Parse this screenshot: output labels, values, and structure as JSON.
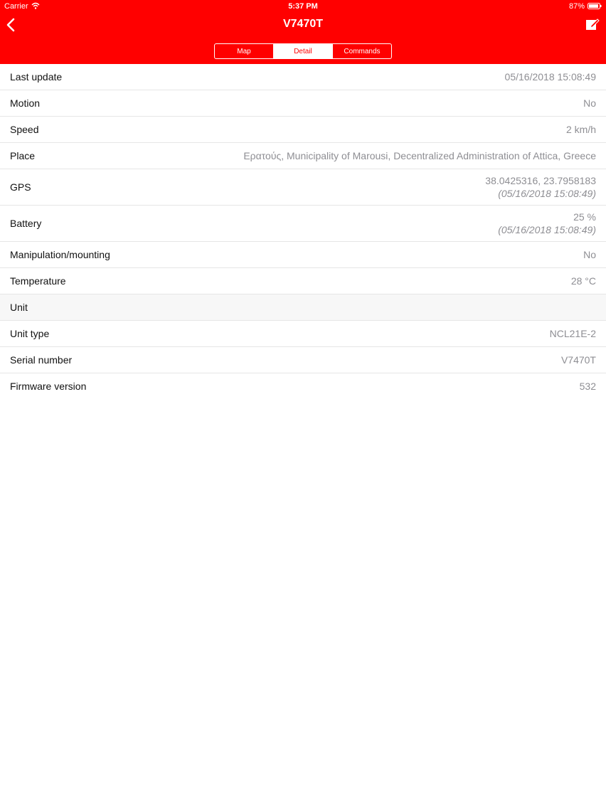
{
  "status_bar": {
    "carrier": "Carrier",
    "time": "5:37 PM",
    "battery": "87%"
  },
  "nav": {
    "title": "V7470T",
    "tabs": [
      {
        "label": "Map",
        "active": false
      },
      {
        "label": "Detail",
        "active": true
      },
      {
        "label": "Commands",
        "active": false
      }
    ],
    "accent_color": "#ff0000"
  },
  "details": {
    "last_update": {
      "label": "Last update",
      "value": "05/16/2018 15:08:49"
    },
    "motion": {
      "label": "Motion",
      "value": "No"
    },
    "speed": {
      "label": "Speed",
      "value": "2 km/h"
    },
    "place": {
      "label": "Place",
      "value": "Ερατούς, Municipality of Marousi, Decentralized Administration of Attica, Greece"
    },
    "gps": {
      "label": "GPS",
      "value": "38.0425316, 23.7958183",
      "sub": "(05/16/2018 15:08:49)"
    },
    "battery": {
      "label": "Battery",
      "value": "25 %",
      "sub": "(05/16/2018 15:08:49)"
    },
    "manipulation": {
      "label": "Manipulation/mounting",
      "value": "No"
    },
    "temperature": {
      "label": "Temperature",
      "value": "28 °C"
    }
  },
  "unit_section": {
    "header": "Unit",
    "unit_type": {
      "label": "Unit type",
      "value": "NCL21E-2"
    },
    "serial_number": {
      "label": "Serial number",
      "value": "V7470T"
    },
    "firmware": {
      "label": "Firmware version",
      "value": "532"
    }
  }
}
